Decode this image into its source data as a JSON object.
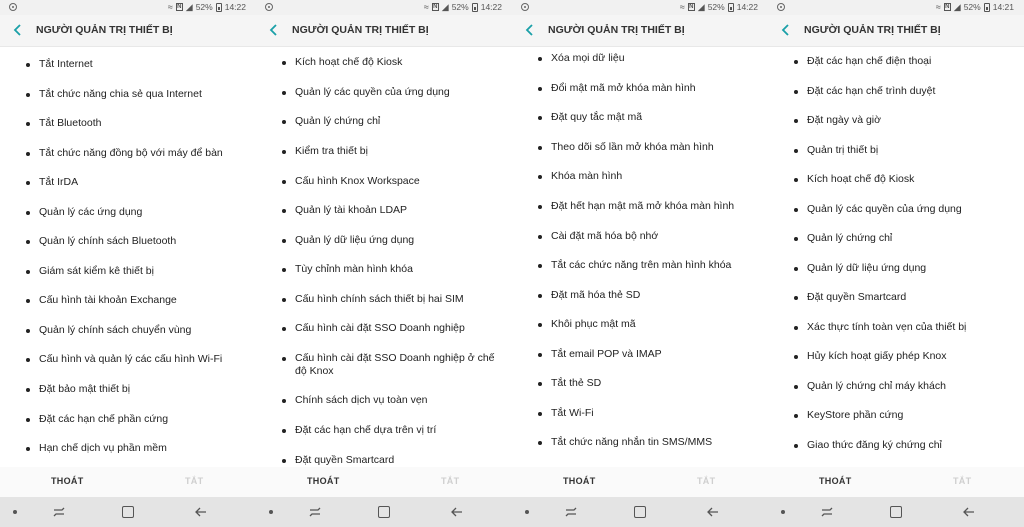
{
  "panels": [
    {
      "status": {
        "battery": "52%",
        "time": "14:22"
      },
      "title": "NGƯỜI QUẢN TRỊ THIẾT BỊ",
      "items": [
        "Tắt Internet",
        "Tắt chức năng chia sẻ qua Internet",
        "Tắt Bluetooth",
        "Tắt chức năng đồng bộ với máy để bàn",
        "Tắt IrDA",
        "Quản lý các ứng dụng",
        "Quản lý chính sách Bluetooth",
        "Giám sát kiểm kê thiết bị",
        "Cấu hình tài khoản Exchange",
        "Quản lý chính sách chuyển vùng",
        "Cấu hình và quản lý các cấu hình Wi-Fi",
        "Đặt bảo mật thiết bị",
        "Đặt các hạn chế phần cứng",
        "Hạn chế dịch vụ phần mềm"
      ],
      "footer": {
        "primary": "THOÁT",
        "secondary": "TẮT"
      }
    },
    {
      "status": {
        "battery": "52%",
        "time": "14:22"
      },
      "title": "NGƯỜI QUẢN TRỊ THIẾT BỊ",
      "items": [
        "Kích hoạt chế độ Kiosk",
        "Quản lý các quyền của ứng dụng",
        "Quản lý chứng chỉ",
        "Kiểm tra thiết bị",
        "Cấu hình Knox Workspace",
        "Quản lý tài khoản LDAP",
        "Quản lý dữ liệu ứng dụng",
        "Tùy chỉnh màn hình khóa",
        "Cấu hình chính sách thiết bị hai SIM",
        "Cấu hình cài đặt SSO Doanh nghiệp",
        "Cấu hình cài đặt SSO Doanh nghiệp ở chế độ Knox",
        "Chính sách dịch vụ toàn vẹn",
        "Đặt các hạn chế dựa trên vị trí",
        "Đặt quyền Smartcard"
      ],
      "footer": {
        "primary": "THOÁT",
        "secondary": "TẮT"
      }
    },
    {
      "status": {
        "battery": "52%",
        "time": "14:22"
      },
      "title": "NGƯỜI QUẢN TRỊ THIẾT BỊ",
      "items": [
        "Xóa mọi dữ liệu",
        "Đổi mật mã mở khóa màn hình",
        "Đặt quy tắc mật mã",
        "Theo dõi số lần mở khóa màn hình",
        "Khóa màn hình",
        "Đặt hết hạn mật mã mở khóa màn hình",
        "Cài đặt mã hóa bộ nhớ",
        "Tắt các chức năng trên màn hình khóa",
        "Đặt mã hóa thẻ SD",
        "Khôi phục mật mã",
        "Tắt email POP và IMAP",
        "Tắt thẻ SD",
        "Tắt Wi-Fi",
        "Tắt chức năng nhắn tin SMS/MMS"
      ],
      "footer": {
        "primary": "THOÁT",
        "secondary": "TẮT"
      }
    },
    {
      "status": {
        "battery": "52%",
        "time": "14:21"
      },
      "title": "NGƯỜI QUẢN TRỊ THIẾT BỊ",
      "items": [
        "Đặt các hạn chế điện thoại",
        "Đặt các hạn chế trình duyệt",
        "Đặt ngày và giờ",
        "Quản trị thiết bị",
        "Kích hoạt chế độ Kiosk",
        "Quản lý các quyền của ứng dụng",
        "Quản lý chứng chỉ",
        "Quản lý dữ liệu ứng dụng",
        "Đặt quyền Smartcard",
        "Xác thực tính toàn vẹn của thiết bị",
        "Hủy kích hoạt giấy phép Knox",
        "Quản lý chứng chỉ máy khách",
        "KeyStore phần cứng",
        "Giao thức đăng ký chứng chỉ"
      ],
      "footer": {
        "primary": "THOÁT",
        "secondary": "TẮT"
      }
    }
  ]
}
